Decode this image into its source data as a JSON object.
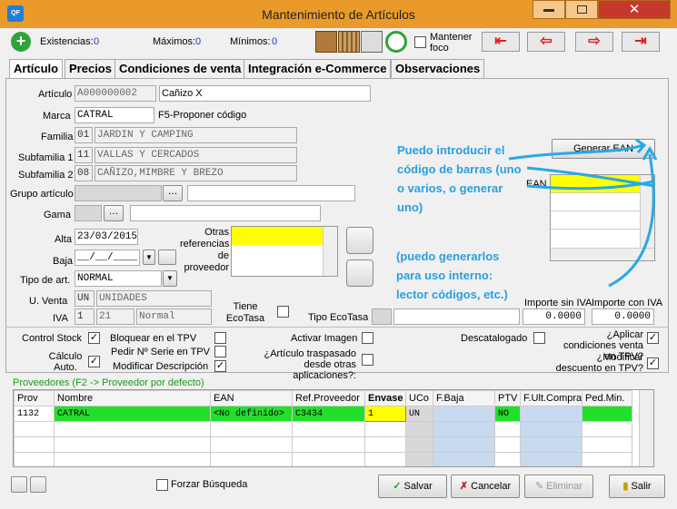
{
  "window": {
    "title": "Mantenimiento de Artículos",
    "app_icon": "QF"
  },
  "toolbar": {
    "existencias_label": "Existencias:",
    "existencias": "0",
    "maximos_label": "Máximos:",
    "maximos": "0",
    "minimos_label": "Mínimos:",
    "minimos": "0",
    "mantener_foco": "Mantener foco"
  },
  "tabs": [
    "Artículo",
    "Precios",
    "Condiciones de venta",
    "Integración e-Commerce",
    "Observaciones"
  ],
  "form": {
    "articulo_label": "Artículo",
    "articulo_code": "A000000002",
    "articulo_name": "Cañizo X",
    "marca_label": "Marca",
    "marca": "CATRAL",
    "marca_hint": "F5-Proponer código",
    "familia_label": "Familia",
    "familia_code": "01",
    "familia_name": "JARDIN Y CAMPING",
    "subfam1_label": "Subfamilia 1",
    "subfam1_code": "11",
    "subfam1_name": "VALLAS Y CERCADOS",
    "subfam2_label": "Subfamilia 2",
    "subfam2_code": "08",
    "subfam2_name": "CAÑIZO,MIMBRE Y BREZO",
    "grupo_label": "Grupo artículo",
    "gama_label": "Gama",
    "alta_label": "Alta",
    "alta": "23/03/2015",
    "baja_label": "Baja",
    "baja": "__/__/____",
    "otras_ref_label": "Otras referencias de proveedor",
    "tipo_label": "Tipo de art.",
    "tipo": "NORMAL",
    "uventa_label": "U. Venta",
    "uventa_code": "UN",
    "uventa_name": "UNIDADES",
    "iva_label": "IVA",
    "iva_code": "1",
    "iva_pct": "21",
    "iva_name": "Normal",
    "ecotasa_label": "Tiene EcoTasa",
    "tipo_ecotasa_label": "Tipo EcoTasa",
    "imp_sin_iva_label": "Importe sin IVA",
    "imp_sin_iva": "0.0000",
    "imp_con_iva_label": "Importe con IVA",
    "imp_con_iva": "0.0000",
    "generar_ean": "Generar EAN",
    "ean_label": "EAN"
  },
  "annotations": {
    "a1": "Puedo introducir el código de barras (uno o varios, o generar uno)",
    "a2": "(puedo generarlos para uso interno: lector códigos, etc.)"
  },
  "checks": {
    "control_stock": "Control Stock",
    "calculo_auto": "Cálculo Auto.",
    "bloquear_tpv": "Bloquear en el TPV",
    "pedir_serie": "Pedir Nº Serie en TPV",
    "mod_desc": "Modificar Descripción",
    "activar_imagen": "Activar Imagen",
    "traspasado": "¿Artículo traspasado desde otras aplicaciones?:",
    "descatalogado": "Descatalogado",
    "aplicar_cond": "¿Aplicar condiciones venta en TPV?",
    "modificar_dto": "¿Modificar descuento en TPV?"
  },
  "proveedores": {
    "header": "Proveedores (F2 -> Proveedor por defecto)",
    "columns": [
      "Prov",
      "Nombre",
      "EAN",
      "Ref.Proveedor",
      "Envase",
      "UCo",
      "F.Baja",
      "PTV",
      "F.Ult.Compra",
      "Ped.Min."
    ],
    "rows": [
      [
        "1132",
        "CATRAL",
        "<No definido>",
        "C3434",
        "1",
        "UN",
        "",
        "NO",
        "",
        ""
      ]
    ]
  },
  "bottom": {
    "forzar": "Forzar Búsqueda",
    "salvar": "Salvar",
    "cancelar": "Cancelar",
    "eliminar": "Eliminar",
    "salir": "Salir"
  }
}
